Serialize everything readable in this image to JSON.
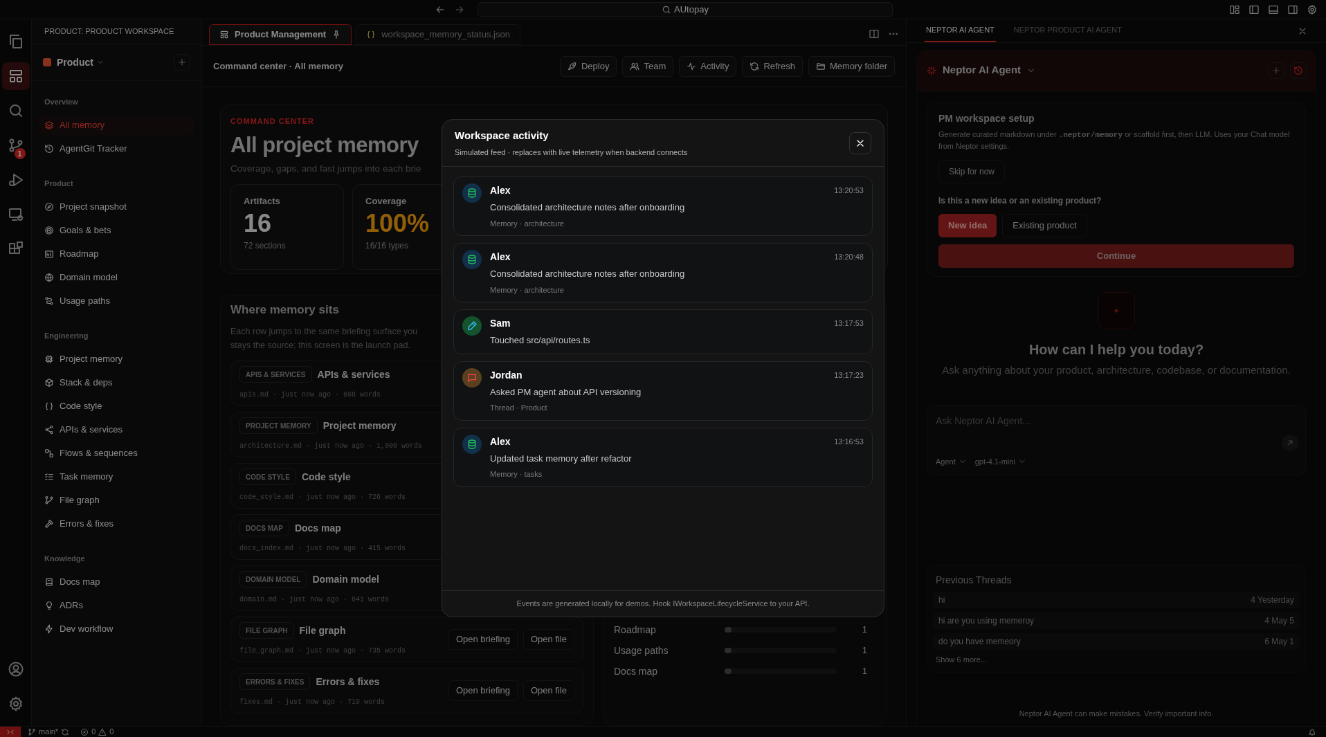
{
  "title_bar": {
    "search": "AUtopay"
  },
  "activity_bar": {
    "items": [
      {
        "selected": false
      },
      {
        "selected": true
      },
      {
        "selected": false
      },
      {
        "selected": false,
        "badge": "1"
      },
      {
        "selected": false
      },
      {
        "selected": false
      },
      {
        "selected": false
      }
    ]
  },
  "sidebar": {
    "title": "PRODUCT: PRODUCT WORKSPACE",
    "workspace": "Product",
    "sections": [
      {
        "label": "Overview",
        "items": [
          {
            "label": "All memory",
            "selected": true
          },
          {
            "label": "AgentGit Tracker",
            "selected": false
          }
        ]
      },
      {
        "label": "Product",
        "items": [
          {
            "label": "Project snapshot",
            "selected": false
          },
          {
            "label": "Goals & bets",
            "selected": false
          },
          {
            "label": "Roadmap",
            "selected": false
          },
          {
            "label": "Domain model",
            "selected": false
          },
          {
            "label": "Usage paths",
            "selected": false
          }
        ]
      },
      {
        "label": "Engineering",
        "items": [
          {
            "label": "Project memory",
            "selected": false
          },
          {
            "label": "Stack & deps",
            "selected": false
          },
          {
            "label": "Code style",
            "selected": false
          },
          {
            "label": "APIs & services",
            "selected": false
          },
          {
            "label": "Flows & sequences",
            "selected": false
          },
          {
            "label": "Task memory",
            "selected": false
          },
          {
            "label": "File graph",
            "selected": false
          },
          {
            "label": "Errors & fixes",
            "selected": false
          }
        ]
      },
      {
        "label": "Knowledge",
        "items": [
          {
            "label": "Docs map",
            "selected": false
          },
          {
            "label": "ADRs",
            "selected": false
          },
          {
            "label": "Dev workflow",
            "selected": false
          }
        ]
      }
    ]
  },
  "editor": {
    "tabs": [
      {
        "label": "Product Management",
        "selected": true,
        "pinned": true
      },
      {
        "label": "workspace_memory_status.json",
        "selected": false,
        "pinned": false
      }
    ],
    "breadcrumb": "Command center · All memory",
    "actions": [
      "Deploy",
      "Team",
      "Activity",
      "Refresh",
      "Memory folder"
    ],
    "command_center": {
      "eyebrow": "COMMAND CENTER",
      "title": "All project memory",
      "subtitle": "Coverage, gaps, and fast jumps into each brie",
      "stats": [
        {
          "label": "Artifacts",
          "value": "16",
          "detail": "72 sections",
          "highlight": false
        },
        {
          "label": "Coverage",
          "value": "100%",
          "detail": "16/16 types",
          "highlight": true
        }
      ]
    },
    "memory": {
      "title": "Where memory sits",
      "lines": [
        "Each row jumps to the same briefing surface you",
        "stays the source; this screen is the launch pad."
      ],
      "rows": [
        {
          "tag": "APIS & SERVICES",
          "title": "APIs & services",
          "meta": "apis.md · just now ago · 608 words",
          "actions": []
        },
        {
          "tag": "PROJECT MEMORY",
          "title": "Project memory",
          "meta": "architecture.md · just now ago · 1,000 words",
          "actions": []
        },
        {
          "tag": "CODE STYLE",
          "title": "Code style",
          "meta": "code_style.md · just now ago · 726 words",
          "actions": []
        },
        {
          "tag": "DOCS MAP",
          "title": "Docs map",
          "meta": "docs_index.md · just now ago · 415 words",
          "actions": []
        },
        {
          "tag": "DOMAIN MODEL",
          "title": "Domain model",
          "meta": "domain.md · just now ago · 641 words",
          "actions": []
        },
        {
          "tag": "FILE GRAPH",
          "title": "File graph",
          "meta": "file_graph.md · just now ago · 735 words",
          "actions": [
            "Open briefing",
            "Open file"
          ]
        },
        {
          "tag": "ERRORS & FIXES",
          "title": "Errors & fixes",
          "meta": "fixes.md · just now ago · 719 words",
          "actions": [
            "Open briefing",
            "Open file"
          ]
        }
      ]
    },
    "coverage_rows": [
      {
        "label": "Roadmap",
        "level": 0.06,
        "count": "1"
      },
      {
        "label": "Usage paths",
        "level": 0.06,
        "count": "1"
      },
      {
        "label": "Docs map",
        "level": 0.06,
        "count": "1"
      }
    ]
  },
  "agent_panel": {
    "tabs": [
      {
        "label": "NEPTOR AI AGENT",
        "selected": true
      },
      {
        "label": "NEPTOR PRODUCT AI AGENT",
        "selected": false
      }
    ],
    "agent_name": "Neptor AI Agent",
    "setup": {
      "title": "PM workspace setup",
      "desc_before": "Generate curated markdown under ",
      "desc_code": ".neptor/memory",
      "desc_after": " or scaffold first, then LLM. Uses your Chat model from Neptor settings.",
      "skip": "Skip for now",
      "question": "Is this a new idea or an existing product?",
      "choices": [
        {
          "label": "New idea",
          "selected": true
        },
        {
          "label": "Existing product",
          "selected": false
        }
      ],
      "continue": "Continue"
    },
    "welcome": {
      "title": "How can I help you today?",
      "subtitle": "Ask anything about your product, architecture, codebase, or documentation."
    },
    "input": {
      "placeholder": "Ask Neptor AI Agent...",
      "mode": "Agent",
      "model": "gpt-4.1-mini"
    },
    "threads": {
      "title": "Previous Threads",
      "items": [
        {
          "title": "hi",
          "meta": "4 Yesterday"
        },
        {
          "title": "hi are you using memeroy",
          "meta": "4 May 5"
        },
        {
          "title": "do you have memeory",
          "meta": "6 May 1"
        }
      ],
      "more": "Show 6 more..."
    },
    "footer": "Neptor AI Agent can make mistakes. Verify important info."
  },
  "modal": {
    "title": "Workspace activity",
    "subtitle": "Simulated feed · replaces with live telemetry when backend connects",
    "events": [
      {
        "kind": "memory",
        "name": "Alex",
        "time": "13:20:53",
        "text": "Consolidated architecture notes after onboarding",
        "meta": "Memory · architecture"
      },
      {
        "kind": "memory",
        "name": "Alex",
        "time": "13:20:48",
        "text": "Consolidated architecture notes after onboarding",
        "meta": "Memory · architecture"
      },
      {
        "kind": "edit",
        "name": "Sam",
        "time": "13:17:53",
        "text": "Touched src/api/routes.ts"
      },
      {
        "kind": "thread",
        "name": "Jordan",
        "time": "13:17:23",
        "text": "Asked PM agent about API versioning",
        "meta": "Thread · Product"
      },
      {
        "kind": "memory",
        "name": "Alex",
        "time": "13:16:53",
        "text": "Updated task memory after refactor",
        "meta": "Memory · tasks"
      }
    ],
    "footer": "Events are generated locally for demos. Hook IWorkspaceLifecycleService to your API."
  },
  "status_bar": {
    "branch": "main*",
    "errors": "0",
    "warnings": "0"
  }
}
